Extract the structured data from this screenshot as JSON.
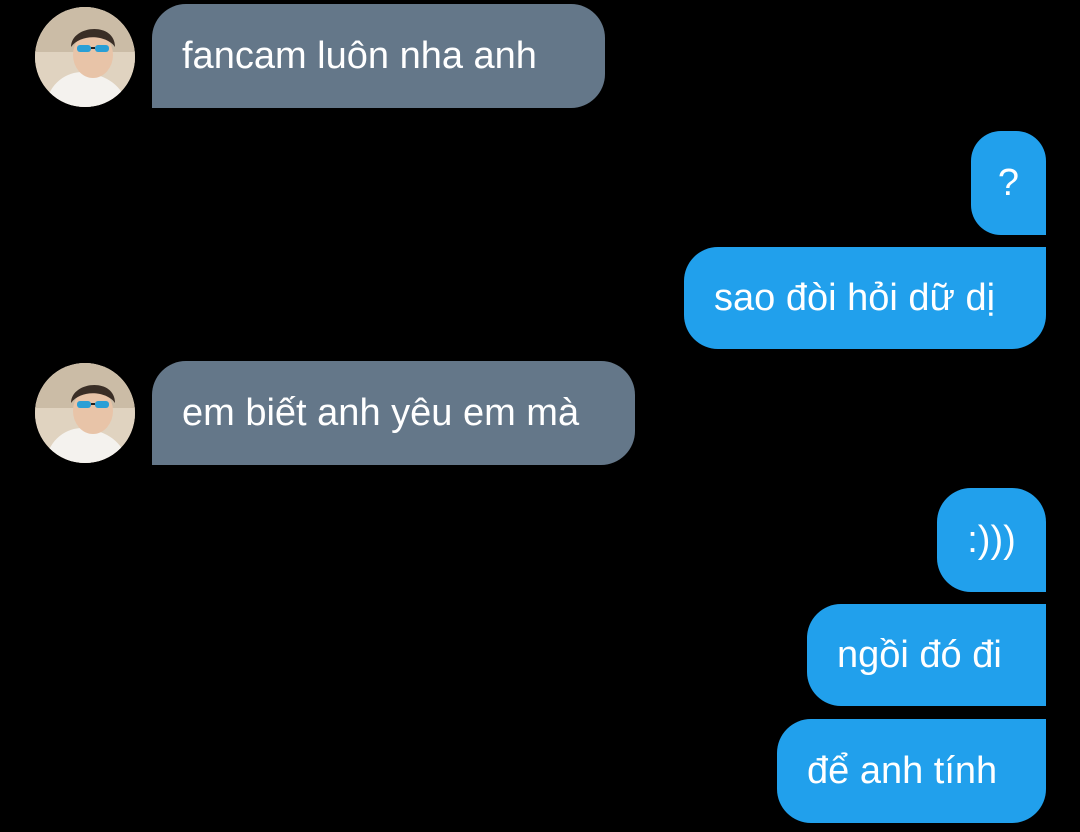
{
  "thread": {
    "messages": [
      {
        "sender": "other",
        "text": "fancam luôn nha anh"
      },
      {
        "sender": "me",
        "text": "?"
      },
      {
        "sender": "me",
        "text": "sao đòi hỏi dữ dị"
      },
      {
        "sender": "other",
        "text": "em biết anh yêu em mà"
      },
      {
        "sender": "me",
        "text": ":)))"
      },
      {
        "sender": "me",
        "text": "ngồi đó đi"
      },
      {
        "sender": "me",
        "text": "để anh tính"
      }
    ]
  },
  "colors": {
    "background": "#000000",
    "received_bubble": "#647789",
    "sent_bubble": "#21a0ec",
    "text": "#ffffff"
  },
  "icons": {
    "avatar": "profile-photo-avatar"
  }
}
